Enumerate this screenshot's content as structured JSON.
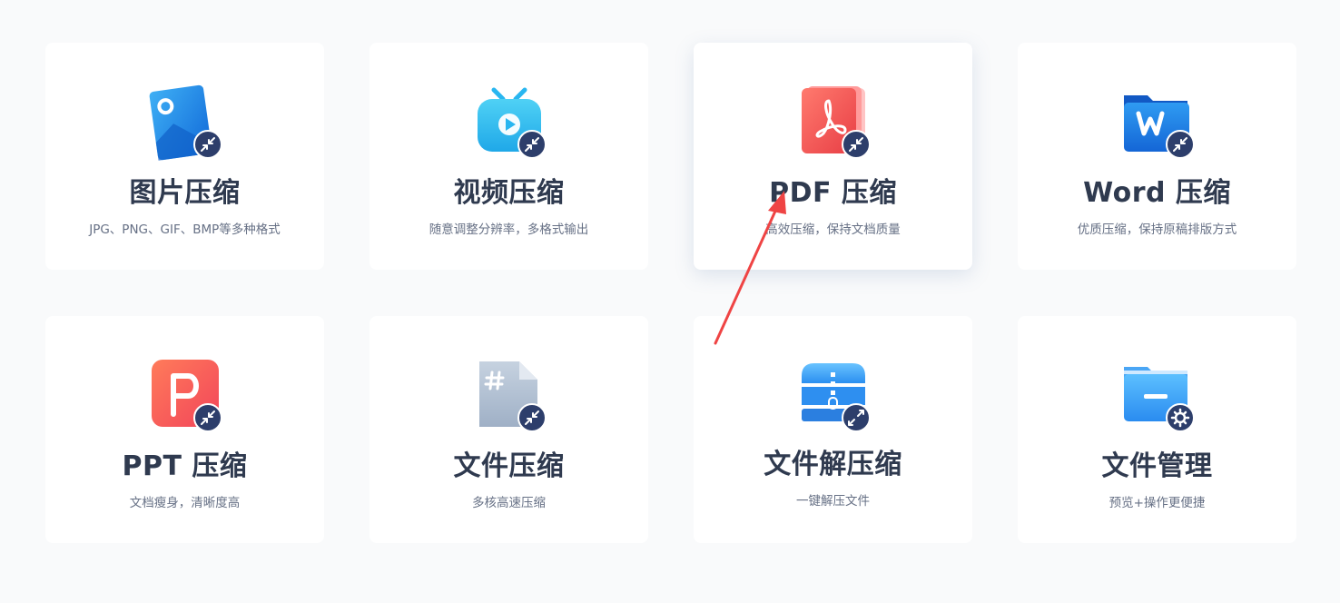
{
  "cards": [
    {
      "title": "图片压缩",
      "desc": "JPG、PNG、GIF、BMP等多种格式",
      "icon": "image-compress-icon"
    },
    {
      "title": "视频压缩",
      "desc": "随意调整分辨率，多格式输出",
      "icon": "video-compress-icon"
    },
    {
      "title": "PDF 压缩",
      "desc": "高效压缩，保持文档质量",
      "icon": "pdf-compress-icon"
    },
    {
      "title": "Word 压缩",
      "desc": "优质压缩，保持原稿排版方式",
      "icon": "word-compress-icon"
    },
    {
      "title": "PPT 压缩",
      "desc": "文档瘦身，清晰度高",
      "icon": "ppt-compress-icon"
    },
    {
      "title": "文件压缩",
      "desc": "多核高速压缩",
      "icon": "file-compress-icon"
    },
    {
      "title": "文件解压缩",
      "desc": "一键解压文件",
      "icon": "file-decompress-icon"
    },
    {
      "title": "文件管理",
      "desc": "预览+操作更便捷",
      "icon": "file-manage-icon"
    }
  ],
  "colors": {
    "accent_blue": "#1e88e5",
    "badge_navy": "#2d3e6b",
    "pdf_red": "#f25757",
    "arrow_red": "#ef4444"
  }
}
